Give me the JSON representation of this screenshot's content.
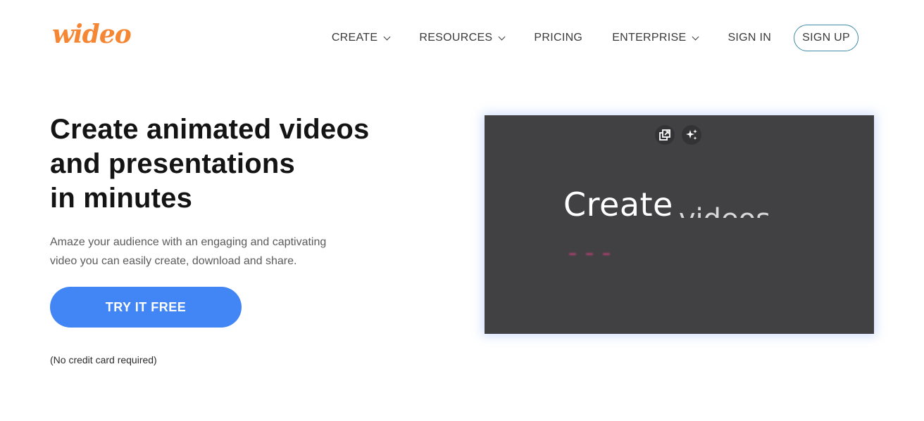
{
  "header": {
    "logo_text": "wideo",
    "nav": [
      {
        "label": "CREATE",
        "has_dropdown": true
      },
      {
        "label": "RESOURCES",
        "has_dropdown": true
      },
      {
        "label": "PRICING",
        "has_dropdown": false
      },
      {
        "label": "ENTERPRISE",
        "has_dropdown": true
      },
      {
        "label": "SIGN IN",
        "has_dropdown": false
      }
    ],
    "signup_label": "SIGN UP"
  },
  "hero": {
    "title_lines": [
      "Create animated videos",
      "and presentations",
      "in minutes"
    ],
    "subtitle_lines": [
      "Amaze your audience with an engaging and captivating",
      "video you can easily create, download and share."
    ],
    "cta_label": "TRY IT FREE",
    "note": "(No credit card required)"
  },
  "video": {
    "headline": "Create",
    "headline_partial": "videos",
    "controls": [
      {
        "icon": "open-external-icon"
      },
      {
        "icon": "sparkle-icon"
      }
    ]
  },
  "colors": {
    "brand": "#f58634",
    "accent": "#4285f4",
    "signup_border": "#3e8aa8",
    "video_bg": "#414143"
  }
}
